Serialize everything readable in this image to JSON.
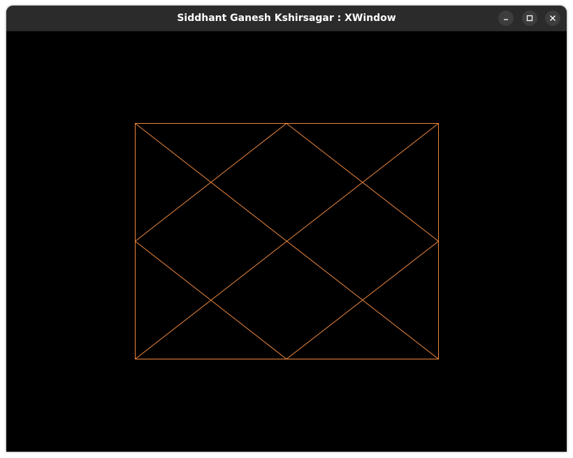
{
  "window": {
    "title": "Siddhant Ganesh Kshirsagar : XWindow",
    "controls": {
      "minimize_icon": "minimize-icon",
      "maximize_icon": "maximize-icon",
      "close_icon": "close-icon"
    }
  },
  "drawing": {
    "background_color": "#000000",
    "stroke_color": "#f0883e",
    "shapes": [
      "rectangle",
      "diamond",
      "diagonals"
    ]
  }
}
